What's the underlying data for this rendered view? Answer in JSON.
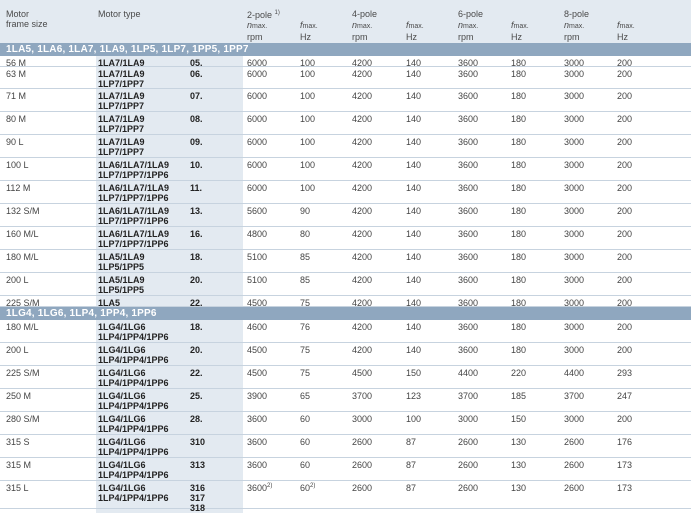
{
  "header": {
    "frame_size": [
      "Motor",
      "frame size"
    ],
    "motor_type": "Motor type",
    "poles": [
      "2-pole",
      "4-pole",
      "6-pole",
      "8-pole"
    ],
    "pole1_note": "1)",
    "n_label": "n",
    "f_label": "f",
    "max_sub": "max.",
    "rpm": "rpm",
    "hz": "Hz"
  },
  "sections": [
    {
      "title": "1LA5, 1LA6, 1LA7, 1LA9, 1LP5, 1LP7, 1PP5, 1PP7",
      "rows": [
        {
          "frame": "56 M",
          "types": [
            "1LA7/1LA9"
          ],
          "codes": [
            "05."
          ],
          "vals": [
            "6000",
            "100",
            "4200",
            "140",
            "3600",
            "180",
            "3000",
            "200"
          ]
        },
        {
          "frame": "63 M",
          "types": [
            "1LA7/1LA9",
            "1LP7/1PP7"
          ],
          "codes": [
            "06."
          ],
          "vals": [
            "6000",
            "100",
            "4200",
            "140",
            "3600",
            "180",
            "3000",
            "200"
          ]
        },
        {
          "frame": "71 M",
          "types": [
            "1LA7/1LA9",
            "1LP7/1PP7"
          ],
          "codes": [
            "07."
          ],
          "vals": [
            "6000",
            "100",
            "4200",
            "140",
            "3600",
            "180",
            "3000",
            "200"
          ]
        },
        {
          "frame": "80 M",
          "types": [
            "1LA7/1LA9",
            "1LP7/1PP7"
          ],
          "codes": [
            "08."
          ],
          "vals": [
            "6000",
            "100",
            "4200",
            "140",
            "3600",
            "180",
            "3000",
            "200"
          ]
        },
        {
          "frame": "90 L",
          "types": [
            "1LA7/1LA9",
            "1LP7/1PP7"
          ],
          "codes": [
            "09."
          ],
          "vals": [
            "6000",
            "100",
            "4200",
            "140",
            "3600",
            "180",
            "3000",
            "200"
          ]
        },
        {
          "frame": "100 L",
          "types": [
            "1LA6/1LA7/1LA9",
            "1LP7/1PP7/1PP6"
          ],
          "codes": [
            "10."
          ],
          "vals": [
            "6000",
            "100",
            "4200",
            "140",
            "3600",
            "180",
            "3000",
            "200"
          ]
        },
        {
          "frame": "112 M",
          "types": [
            "1LA6/1LA7/1LA9",
            "1LP7/1PP7/1PP6"
          ],
          "codes": [
            "11."
          ],
          "vals": [
            "6000",
            "100",
            "4200",
            "140",
            "3600",
            "180",
            "3000",
            "200"
          ]
        },
        {
          "frame": "132 S/M",
          "types": [
            "1LA6/1LA7/1LA9",
            "1LP7/1PP7/1PP6"
          ],
          "codes": [
            "13."
          ],
          "vals": [
            "5600",
            "90",
            "4200",
            "140",
            "3600",
            "180",
            "3000",
            "200"
          ]
        },
        {
          "frame": "160 M/L",
          "types": [
            "1LA6/1LA7/1LA9",
            "1LP7/1PP7/1PP6"
          ],
          "codes": [
            "16."
          ],
          "vals": [
            "4800",
            "80",
            "4200",
            "140",
            "3600",
            "180",
            "3000",
            "200"
          ]
        },
        {
          "frame": "180 M/L",
          "types": [
            "1LA5/1LA9",
            "1LP5/1PP5"
          ],
          "codes": [
            "18."
          ],
          "vals": [
            "5100",
            "85",
            "4200",
            "140",
            "3600",
            "180",
            "3000",
            "200"
          ]
        },
        {
          "frame": "200 L",
          "types": [
            "1LA5/1LA9",
            "1LP5/1PP5"
          ],
          "codes": [
            "20."
          ],
          "vals": [
            "5100",
            "85",
            "4200",
            "140",
            "3600",
            "180",
            "3000",
            "200"
          ]
        },
        {
          "frame": "225 S/M",
          "types": [
            "1LA5"
          ],
          "codes": [
            "22."
          ],
          "vals": [
            "4500",
            "75",
            "4200",
            "140",
            "3600",
            "180",
            "3000",
            "200"
          ]
        }
      ]
    },
    {
      "title": "1LG4, 1LG6, 1LP4, 1PP4, 1PP6",
      "rows": [
        {
          "frame": "180 M/L",
          "types": [
            "1LG4/1LG6",
            "1LP4/1PP4/1PP6"
          ],
          "codes": [
            "18."
          ],
          "vals": [
            "4600",
            "76",
            "4200",
            "140",
            "3600",
            "180",
            "3000",
            "200"
          ]
        },
        {
          "frame": "200 L",
          "types": [
            "1LG4/1LG6",
            "1LP4/1PP4/1PP6"
          ],
          "codes": [
            "20."
          ],
          "vals": [
            "4500",
            "75",
            "4200",
            "140",
            "3600",
            "180",
            "3000",
            "200"
          ]
        },
        {
          "frame": "225 S/M",
          "types": [
            "1LG4/1LG6",
            "1LP4/1PP4/1PP6"
          ],
          "codes": [
            "22."
          ],
          "vals": [
            "4500",
            "75",
            "4500",
            "150",
            "4400",
            "220",
            "4400",
            "293"
          ]
        },
        {
          "frame": "250 M",
          "types": [
            "1LG4/1LG6",
            "1LP4/1PP4/1PP6"
          ],
          "codes": [
            "25."
          ],
          "vals": [
            "3900",
            "65",
            "3700",
            "123",
            "3700",
            "185",
            "3700",
            "247"
          ]
        },
        {
          "frame": "280 S/M",
          "types": [
            "1LG4/1LG6",
            "1LP4/1PP4/1PP6"
          ],
          "codes": [
            "28."
          ],
          "vals": [
            "3600",
            "60",
            "3000",
            "100",
            "3000",
            "150",
            "3000",
            "200"
          ]
        },
        {
          "frame": "315 S",
          "types": [
            "1LG4/1LG6",
            "1LP4/1PP4/1PP6"
          ],
          "codes": [
            "310"
          ],
          "vals": [
            "3600",
            "60",
            "2600",
            "87",
            "2600",
            "130",
            "2600",
            "176"
          ]
        },
        {
          "frame": "315 M",
          "types": [
            "1LG4/1LG6",
            "1LP4/1PP4/1PP6"
          ],
          "codes": [
            "313"
          ],
          "vals": [
            "3600",
            "60",
            "2600",
            "87",
            "2600",
            "130",
            "2600",
            "173"
          ]
        },
        {
          "frame": "315 L",
          "types": [
            "1LG4/1LG6",
            "1LP4/1PP4/1PP6"
          ],
          "codes": [
            "316",
            "317",
            "318"
          ],
          "vals": [
            "3600",
            "60",
            "2600",
            "87",
            "2600",
            "130",
            "2600",
            "173"
          ],
          "notes": [
            "2)",
            "2)"
          ]
        }
      ]
    }
  ]
}
